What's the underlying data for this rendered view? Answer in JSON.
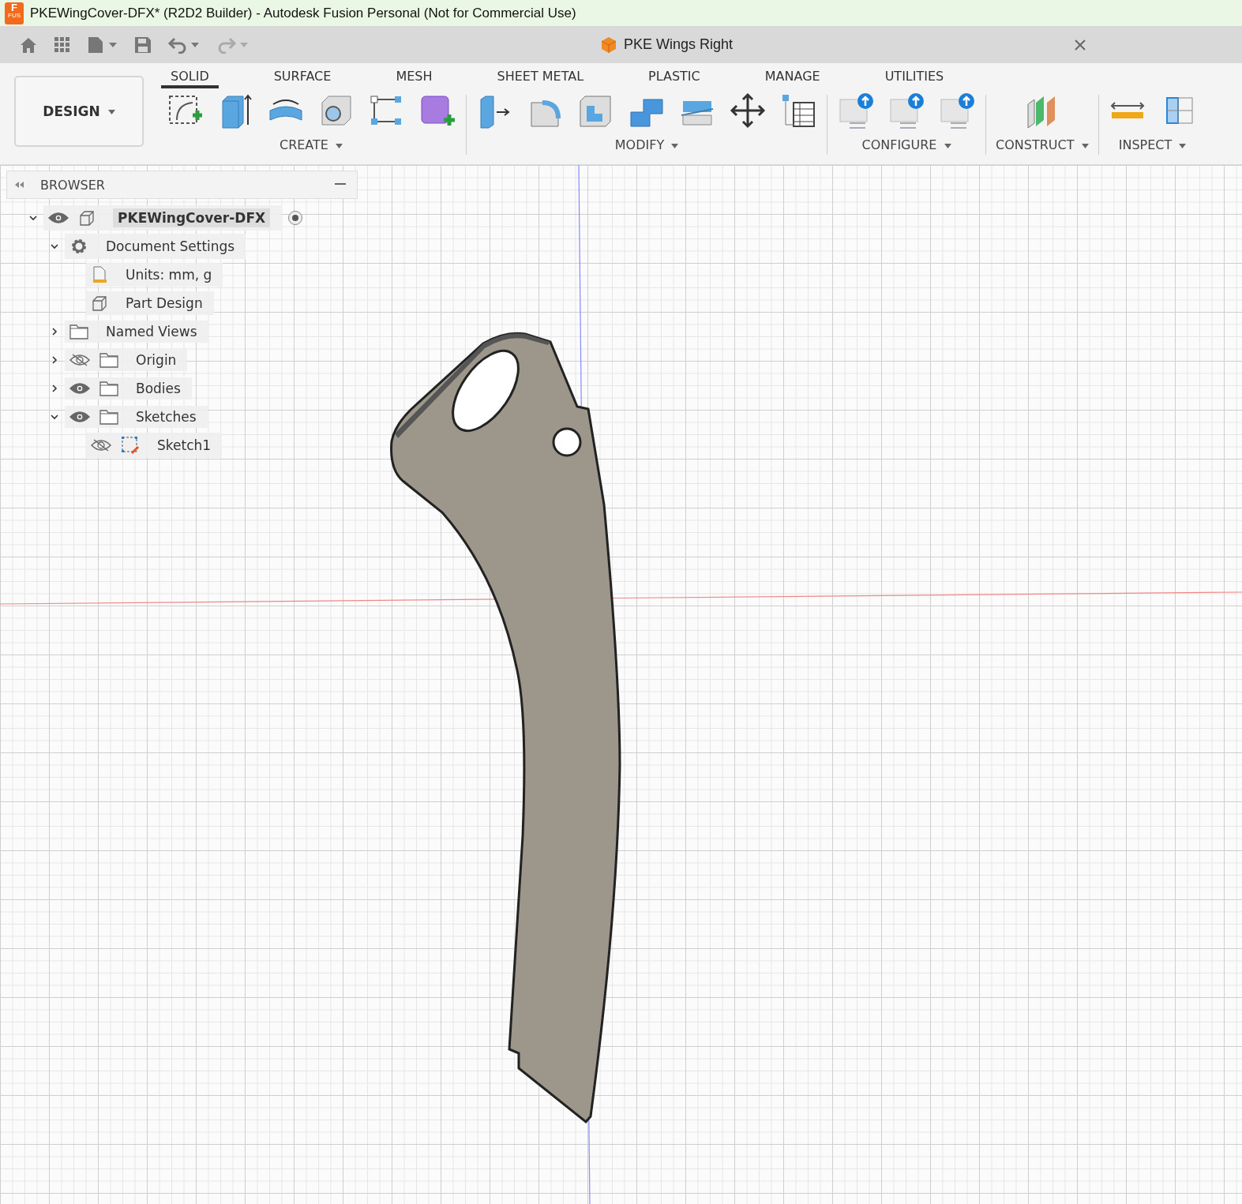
{
  "window": {
    "title": "PKEWingCover-DFX* (R2D2 Builder) - Autodesk Fusion Personal (Not for Commercial Use)",
    "app_icon": {
      "letter": "F",
      "sub": "FUS"
    }
  },
  "document_tab": {
    "title": "PKE Wings Right"
  },
  "workspace": {
    "label": "DESIGN"
  },
  "tabs": [
    {
      "label": "SOLID",
      "selected": true
    },
    {
      "label": "SURFACE",
      "selected": false
    },
    {
      "label": "MESH",
      "selected": false
    },
    {
      "label": "SHEET METAL",
      "selected": false
    },
    {
      "label": "PLASTIC",
      "selected": false
    },
    {
      "label": "MANAGE",
      "selected": false
    },
    {
      "label": "UTILITIES",
      "selected": false
    }
  ],
  "tool_groups": [
    {
      "label": "CREATE"
    },
    {
      "label": "MODIFY"
    },
    {
      "label": "CONFIGURE"
    },
    {
      "label": "CONSTRUCT"
    },
    {
      "label": "INSPECT"
    }
  ],
  "browser": {
    "title": "BROWSER",
    "tree": [
      {
        "label": "PKEWingCover-DFX",
        "kind": "component",
        "visible": true,
        "expanded": true,
        "children": [
          {
            "label": "Document Settings",
            "kind": "settings",
            "expanded": true,
            "children": [
              {
                "label": "Units: mm, g",
                "kind": "units"
              },
              {
                "label": "Part Design",
                "kind": "part"
              }
            ]
          },
          {
            "label": "Named Views",
            "kind": "folder",
            "expanded": false
          },
          {
            "label": "Origin",
            "kind": "folder",
            "visible": false,
            "expanded": false
          },
          {
            "label": "Bodies",
            "kind": "folder",
            "visible": true,
            "expanded": false
          },
          {
            "label": "Sketches",
            "kind": "folder",
            "visible": true,
            "expanded": true,
            "children": [
              {
                "label": "Sketch1",
                "kind": "sketch",
                "visible": false
              }
            ]
          }
        ]
      }
    ]
  }
}
